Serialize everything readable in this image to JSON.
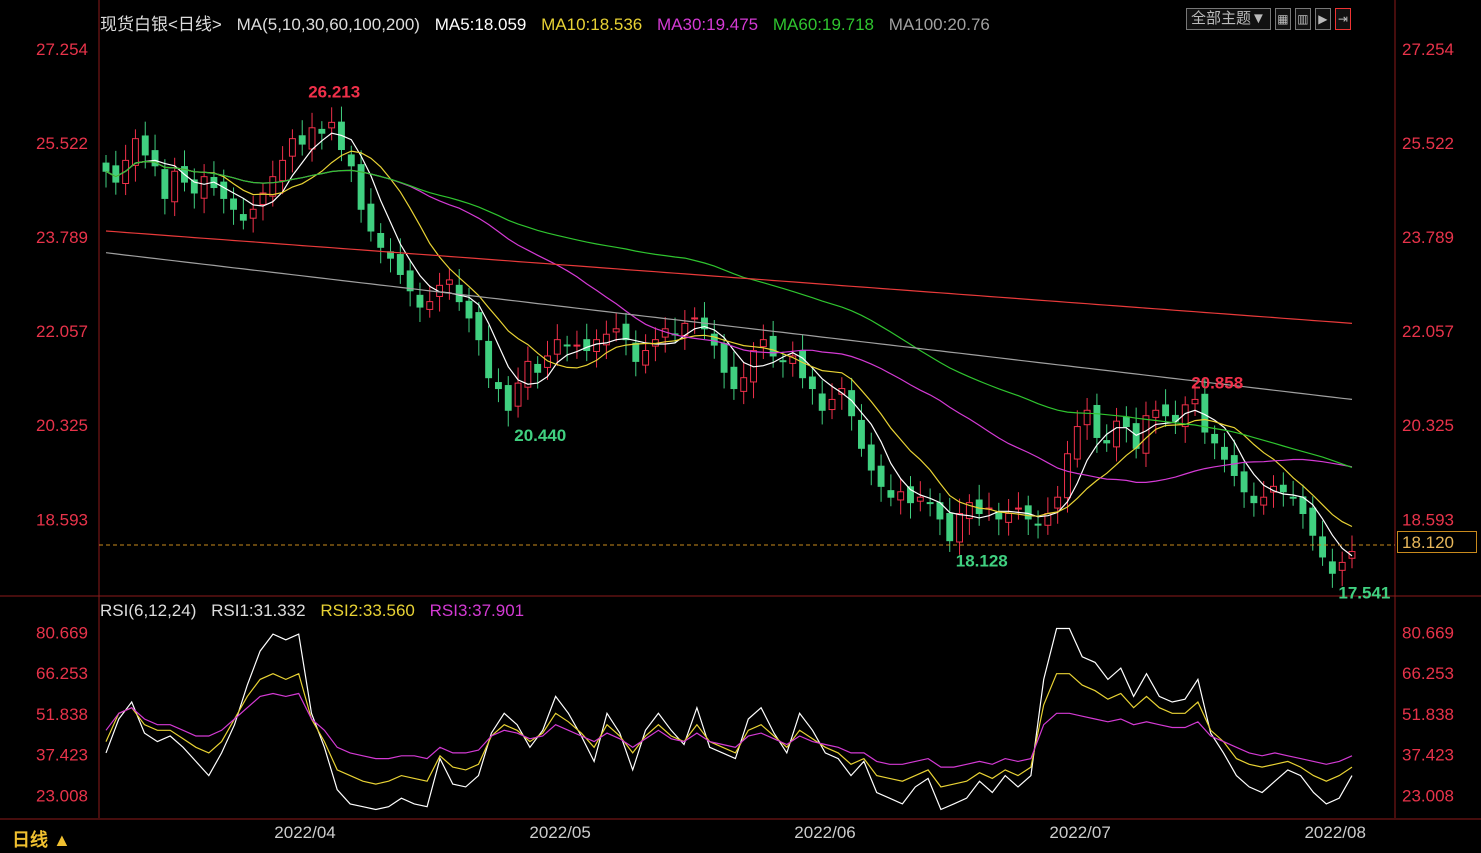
{
  "header": {
    "symbol": "现货白银<日线>",
    "ma_params": "MA(5,10,30,60,100,200)",
    "ma5": "MA5:18.059",
    "ma10": "MA10:18.536",
    "ma30": "MA30:19.475",
    "ma60": "MA60:19.718",
    "ma100": "MA100:20.76"
  },
  "toolbar": {
    "theme_select": "全部主题▼",
    "icons": [
      "grid-icon",
      "layout-icon",
      "play-icon",
      "expand-icon"
    ]
  },
  "rsi_header": {
    "params": "RSI(6,12,24)",
    "rsi1": "RSI1:31.332",
    "rsi2": "RSI2:33.560",
    "rsi3": "RSI3:37.901"
  },
  "period_label": "日线 ▲",
  "current_price": "18.120",
  "colors": {
    "up": "#f0304a",
    "down": "#40d080",
    "ma5": "#ffffff",
    "ma10": "#e8d234",
    "ma30": "#d43ad4",
    "ma60": "#2fc42f",
    "ma100": "#a0a0a0",
    "ma200": "#e83a3a",
    "axis": "#e8334a",
    "dash": "#c88a1d"
  },
  "chart_data": [
    {
      "type": "candlestick",
      "title": "现货白银 日线",
      "price_ticks": [
        "27.254",
        "25.522",
        "23.789",
        "22.057",
        "20.325",
        "18.593"
      ],
      "ylim": [
        17.2,
        27.6
      ],
      "x_labels": [
        "2022/04",
        "2022/05",
        "2022/06",
        "2022/07",
        "2022/08"
      ],
      "annotations": [
        {
          "label": "26.213",
          "type": "high"
        },
        {
          "label": "20.440",
          "type": "low"
        },
        {
          "label": "18.128",
          "type": "low"
        },
        {
          "label": "20.858",
          "type": "high"
        },
        {
          "label": "17.541",
          "type": "low"
        }
      ],
      "close": [
        25.0,
        24.8,
        25.2,
        25.6,
        25.3,
        25.1,
        24.5,
        25.0,
        24.8,
        24.6,
        24.9,
        24.7,
        24.5,
        24.3,
        24.1,
        24.3,
        24.6,
        24.9,
        25.2,
        25.6,
        25.5,
        25.8,
        25.7,
        25.9,
        25.4,
        25.1,
        24.3,
        23.9,
        23.6,
        23.4,
        23.1,
        22.8,
        22.5,
        22.6,
        22.9,
        23.0,
        22.6,
        22.3,
        21.9,
        21.2,
        21.0,
        20.6,
        21.1,
        21.5,
        21.3,
        21.6,
        21.9,
        21.8,
        21.8,
        21.7,
        21.9,
        22.0,
        22.1,
        21.9,
        21.5,
        21.7,
        21.9,
        22.1,
        22.0,
        22.2,
        22.3,
        22.1,
        21.8,
        21.3,
        21.0,
        21.2,
        21.7,
        21.9,
        21.6,
        21.5,
        21.6,
        21.2,
        21.0,
        20.6,
        20.8,
        21.0,
        20.5,
        19.9,
        19.5,
        19.2,
        19.0,
        19.1,
        18.9,
        19.0,
        18.9,
        18.6,
        18.2,
        18.7,
        18.9,
        18.7,
        18.8,
        18.6,
        18.7,
        18.8,
        18.6,
        18.5,
        18.7,
        19.0,
        19.8,
        20.3,
        20.6,
        20.1,
        20.0,
        20.4,
        20.3,
        19.9,
        20.5,
        20.6,
        20.5,
        20.4,
        20.7,
        20.8,
        20.2,
        20.0,
        19.7,
        19.4,
        19.1,
        18.9,
        19.0,
        19.2,
        19.1,
        19.0,
        18.7,
        18.3,
        17.9,
        17.6,
        17.8,
        18.0
      ],
      "rsi": {
        "ticks": [
          "80.669",
          "66.253",
          "51.838",
          "37.423",
          "23.008"
        ],
        "ylim": [
          15,
          85
        ],
        "series": [
          {
            "name": "RSI1",
            "values": [
              38,
              50,
              56,
              45,
              42,
              44,
              40,
              35,
              30,
              38,
              48,
              62,
              74,
              80,
              78,
              80,
              52,
              40,
              25,
              20,
              19,
              18,
              19,
              22,
              20,
              19,
              36,
              27,
              26,
              30,
              45,
              52,
              48,
              40,
              46,
              58,
              52,
              44,
              35,
              52,
              45,
              32,
              46,
              52,
              46,
              41,
              54,
              40,
              38,
              36,
              50,
              54,
              45,
              38,
              52,
              46,
              38,
              36,
              30,
              35,
              24,
              22,
              20,
              26,
              29,
              18,
              20,
              22,
              28,
              24,
              30,
              26,
              30,
              64,
              82,
              82,
              72,
              70,
              64,
              68,
              58,
              66,
              58,
              56,
              57,
              64,
              45,
              38,
              30,
              26,
              24,
              28,
              32,
              30,
              24,
              20,
              22,
              30
            ]
          },
          {
            "name": "RSI2",
            "values": [
              42,
              52,
              54,
              48,
              46,
              46,
              43,
              40,
              38,
              42,
              50,
              58,
              64,
              66,
              64,
              66,
              50,
              42,
              32,
              30,
              28,
              27,
              28,
              30,
              29,
              28,
              37,
              33,
              32,
              34,
              44,
              48,
              46,
              42,
              45,
              52,
              49,
              45,
              40,
              48,
              44,
              38,
              44,
              48,
              44,
              42,
              48,
              42,
              40,
              38,
              46,
              48,
              44,
              40,
              46,
              43,
              40,
              38,
              34,
              36,
              30,
              29,
              28,
              30,
              32,
              26,
              27,
              28,
              31,
              29,
              32,
              30,
              33,
              55,
              66,
              66,
              62,
              60,
              57,
              59,
              54,
              58,
              54,
              52,
              52,
              56,
              46,
              42,
              36,
              34,
              33,
              34,
              35,
              33,
              30,
              28,
              30,
              33
            ]
          },
          {
            "name": "RSI3",
            "values": [
              46,
              52,
              54,
              50,
              48,
              48,
              46,
              44,
              44,
              46,
              50,
              54,
              58,
              59,
              58,
              59,
              50,
              46,
              40,
              38,
              37,
              36,
              36,
              37,
              37,
              36,
              40,
              38,
              38,
              39,
              44,
              46,
              45,
              43,
              44,
              48,
              46,
              44,
              42,
              45,
              43,
              40,
              43,
              46,
              43,
              42,
              45,
              42,
              41,
              40,
              44,
              45,
              43,
              41,
              44,
              42,
              41,
              40,
              38,
              38,
              35,
              34,
              34,
              35,
              36,
              33,
              33,
              34,
              35,
              34,
              36,
              35,
              36,
              48,
              52,
              52,
              51,
              50,
              49,
              50,
              48,
              49,
              48,
              47,
              47,
              49,
              44,
              42,
              40,
              38,
              37,
              38,
              37,
              36,
              35,
              34,
              35,
              37
            ]
          }
        ]
      }
    }
  ]
}
